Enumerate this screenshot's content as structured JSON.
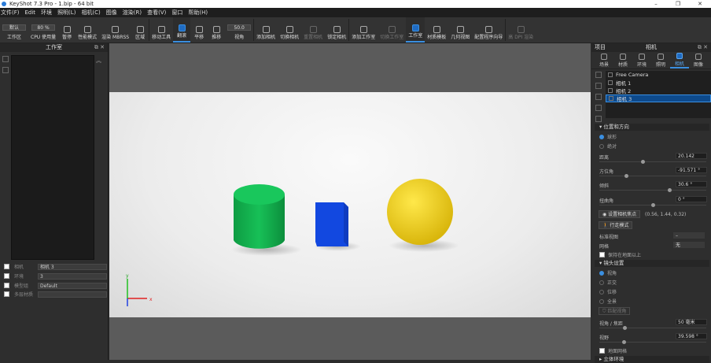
{
  "title": "KeyShot 7.3 Pro  - 1.bip  - 64 bit",
  "menu": [
    "文件(F)",
    "Edit",
    "环境",
    "照明(L)",
    "相机(C)",
    "图像",
    "渲染(R)",
    "查看(V)",
    "窗口",
    "帮助(H)"
  ],
  "toolbar": {
    "workspace_value": "默认",
    "cpu_value": "80 %",
    "fov_value": "50.0",
    "buttons": [
      "工作区",
      "CPU 使用量",
      "暂停",
      "性能模式",
      "渲染 MBRSS",
      "区域",
      "移动工具",
      "翻滚",
      "平移",
      "推移",
      "视角",
      "添加相机",
      "切换相机",
      "重置相机",
      "锁定相机",
      "添加工作室",
      "切换工作室",
      "工作室",
      "材质模板",
      "几何视图",
      "配置程序向导",
      "高 DPI 渲染"
    ]
  },
  "left_panel": {
    "title": "工作室",
    "rows": [
      {
        "label": "相机",
        "value": "相机 3"
      },
      {
        "label": "环境",
        "value": "3"
      },
      {
        "label": "模型组",
        "value": "Default"
      },
      {
        "label": "多层材质",
        "value": ""
      }
    ]
  },
  "right_panel": {
    "header_left": "项目",
    "header_title": "相机",
    "tabs": [
      "场景",
      "材质",
      "环境",
      "照明",
      "相机",
      "图像"
    ],
    "cameras": [
      "Free Camera",
      "相机 1",
      "相机 2",
      "相机 3"
    ],
    "position_section": "位置和方向",
    "mode_options": [
      "球形",
      "绝对"
    ],
    "distance_label": "距离",
    "distance": "20.142",
    "azimuth_label": "方位角",
    "azimuth": "-91.571 °",
    "inclination_label": "倾斜",
    "inclination": "30.6 °",
    "twist_label": "扭曲角",
    "twist": "0 °",
    "set_pivot": "设置相机焦点",
    "pivot_coords": "(0.56, 1.44, 0.32)",
    "walk_mode": "行走模式",
    "std_view_label": "标准视图",
    "std_view": "–",
    "grid_label": "网格",
    "grid": "无",
    "keep_above_ground": "保持在地面以上",
    "lens_section": "镜头设置",
    "lens_options": [
      "视角",
      "正交",
      "位移",
      "全景"
    ],
    "match_view": "匹配视角",
    "focal_label": "视角 / 焦距",
    "focal": "50 毫米",
    "fov_label": "视野",
    "fov": "39.598 °",
    "ground_grid": "地面网格",
    "next_section": "立体环境"
  },
  "colors": {
    "accent": "#3b8fe0",
    "cylinder": "#12b34f",
    "cube": "#1248e0",
    "sphere": "#f2d21a"
  },
  "axis": {
    "x": "x",
    "y": "y"
  }
}
